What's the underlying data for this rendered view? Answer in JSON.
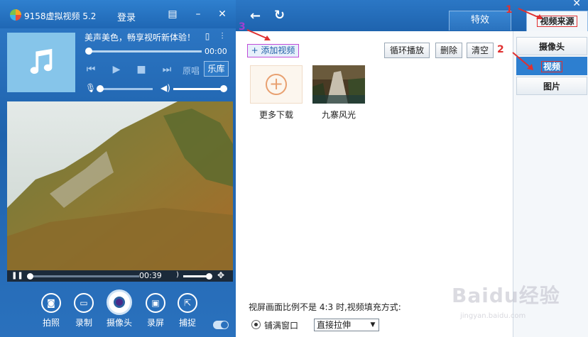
{
  "player": {
    "title": "9158虚拟视频 5.2",
    "login": "登录",
    "song": "美声美色，畅享视听新体验！",
    "time": "00:00",
    "yuanchang": "原唱",
    "leku": "乐库"
  },
  "video": {
    "time": "00:39"
  },
  "bottom": {
    "photo": "拍照",
    "record": "录制",
    "camera": "摄像头",
    "screen": "录屏",
    "capture": "捕捉"
  },
  "tabs": {
    "effects": "特效",
    "source": "视频来源"
  },
  "toolbar": {
    "add_video": "+ 添加视频",
    "loop": "循环播放",
    "delete": "删除",
    "clear": "清空"
  },
  "items": [
    {
      "label": "更多下载"
    },
    {
      "label": "九寨风光"
    }
  ],
  "settings": {
    "ratio_text": "视屏画面比例不是 4:3 时,视频填充方式:",
    "fill_window": "铺满窗口",
    "fill_mode": "直接拉伸"
  },
  "sidebar": {
    "items": [
      "摄像头",
      "视频",
      "图片"
    ]
  },
  "annotations": {
    "n1": "1",
    "n2": "2",
    "n3": "3"
  },
  "watermark": {
    "brand": "Baidu经验",
    "url": "jingyan.baidu.com"
  },
  "colors": {
    "title_bar": "#1f67b4",
    "accent": "#2d7fd0",
    "annotation_red": "#e03030",
    "annotation_purple": "#a040d0"
  }
}
